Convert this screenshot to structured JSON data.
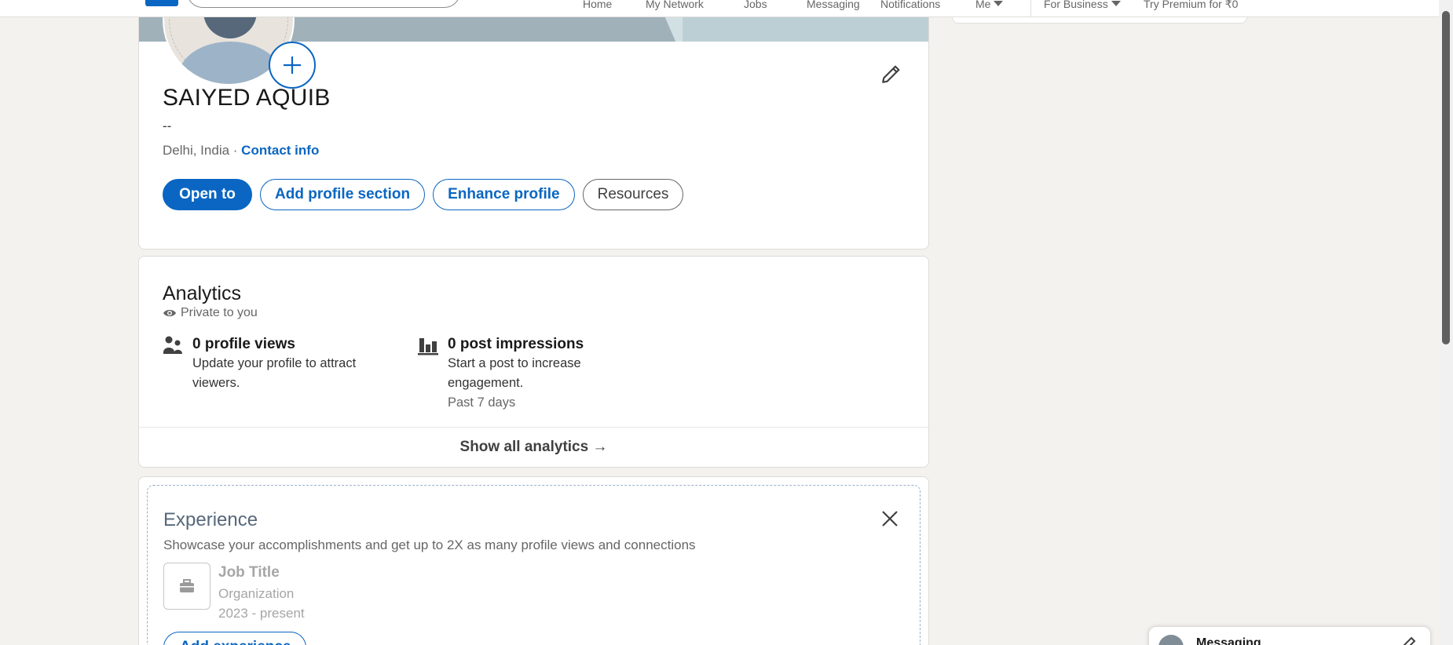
{
  "nav": {
    "items": [
      {
        "label": "Home"
      },
      {
        "label": "My Network"
      },
      {
        "label": "Jobs"
      },
      {
        "label": "Messaging"
      },
      {
        "label": "Notifications"
      },
      {
        "label": "Me"
      },
      {
        "label": "For Business"
      },
      {
        "label": "Try Premium for ₹0"
      }
    ]
  },
  "profile": {
    "name": "SAIYED AQUIB",
    "headline": "--",
    "location": "Delhi, India",
    "separator": " · ",
    "contact_link": "Contact info",
    "buttons": {
      "open_to": "Open to",
      "add_section": "Add profile section",
      "enhance": "Enhance profile",
      "resources": "Resources"
    }
  },
  "analytics": {
    "title": "Analytics",
    "privacy": "Private to you",
    "profile_views": {
      "title": "0 profile views",
      "desc": "Update your profile to attract viewers."
    },
    "post_impressions": {
      "title": "0 post impressions",
      "desc": "Start a post to increase engagement.",
      "period": "Past 7 days"
    },
    "show_all": "Show all analytics →"
  },
  "experience": {
    "title": "Experience",
    "description": "Showcase your accomplishments and get up to 2X as many profile views and connections",
    "placeholder": {
      "job_title": "Job Title",
      "organization": "Organization",
      "dates": "2023 - present"
    },
    "add_button": "Add experience"
  },
  "messaging": {
    "label": "Messaging"
  },
  "colors": {
    "brand": "#0a66c2",
    "page_bg": "#f4f2ee"
  }
}
